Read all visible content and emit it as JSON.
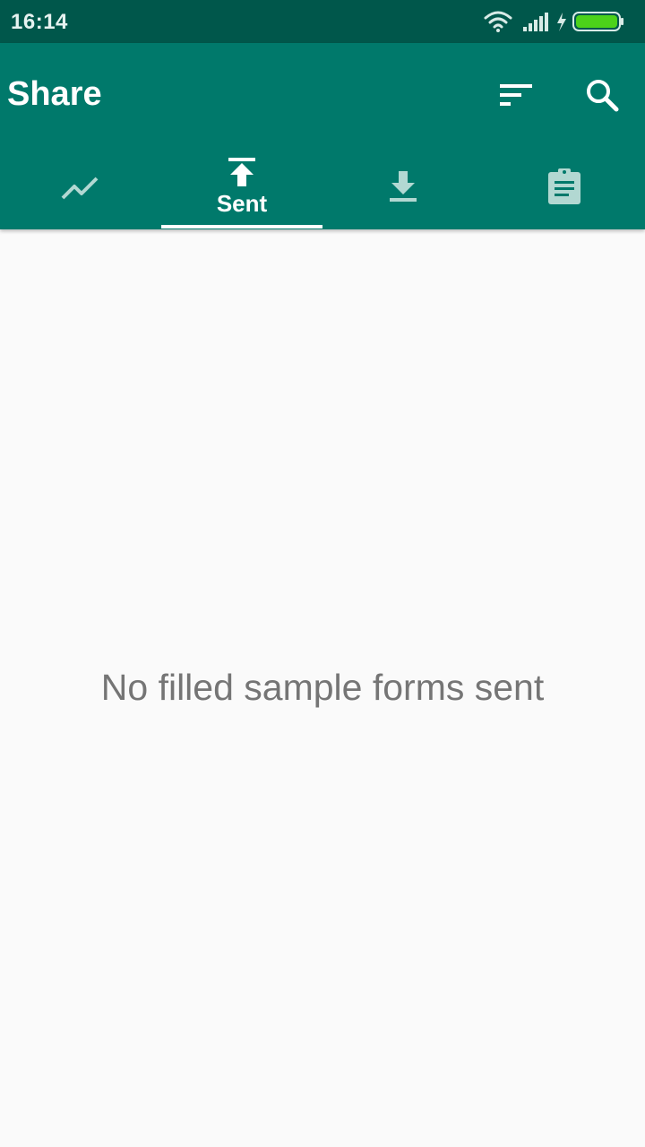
{
  "status_bar": {
    "time": "16:14",
    "icons": [
      "wifi-icon",
      "signal-icon",
      "charging-icon",
      "battery-icon"
    ],
    "battery_color": "#4cd21a"
  },
  "app_bar": {
    "title": "Share",
    "color": "#00796b",
    "actions": [
      "sort-icon",
      "search-icon"
    ]
  },
  "tabs": [
    {
      "icon": "trending-icon",
      "label": "",
      "selected": false
    },
    {
      "icon": "upload-icon",
      "label": "Sent",
      "selected": true
    },
    {
      "icon": "download-icon",
      "label": "",
      "selected": false
    },
    {
      "icon": "clipboard-icon",
      "label": "",
      "selected": false
    }
  ],
  "main": {
    "empty_message": "No filled sample forms sent"
  }
}
